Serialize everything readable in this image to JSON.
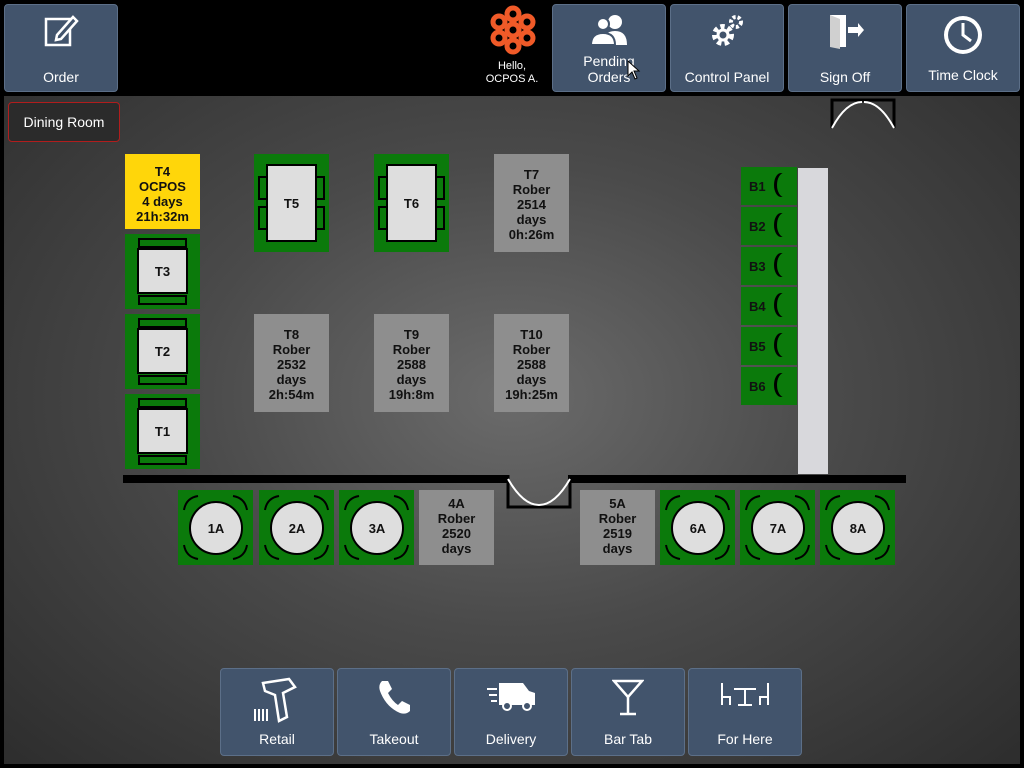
{
  "topbar": {
    "order_label": "Order",
    "hello_line1": "Hello,",
    "hello_line2": "OCPOS A.",
    "pending_line1": "Pending",
    "pending_line2": "Orders",
    "control_panel_label": "Control Panel",
    "sign_off_label": "Sign Off",
    "time_clock_label": "Time Clock"
  },
  "room": {
    "name": "Dining Room"
  },
  "tables": {
    "T4": {
      "line1": "T4",
      "line2": "OCPOS",
      "line3": "4 days",
      "line4": "21h:32m",
      "status": "yellow"
    },
    "T3": {
      "label": "T3"
    },
    "T2": {
      "label": "T2"
    },
    "T1": {
      "label": "T1"
    },
    "T5": {
      "label": "T5"
    },
    "T6": {
      "label": "T6"
    },
    "T7": {
      "line1": "T7",
      "line2": "Rober",
      "line3": "2514",
      "line4": "days",
      "line5": "0h:26m"
    },
    "T8": {
      "line1": "T8",
      "line2": "Rober",
      "line3": "2532",
      "line4": "days",
      "line5": "2h:54m"
    },
    "T9": {
      "line1": "T9",
      "line2": "Rober",
      "line3": "2588",
      "line4": "days",
      "line5": "19h:8m"
    },
    "T10": {
      "line1": "T10",
      "line2": "Rober",
      "line3": "2588",
      "line4": "days",
      "line5": "19h:25m"
    },
    "1A": {
      "label": "1A"
    },
    "2A": {
      "label": "2A"
    },
    "3A": {
      "label": "3A"
    },
    "4A": {
      "line1": "4A",
      "line2": "Rober",
      "line3": "2520",
      "line4": "days"
    },
    "5A": {
      "line1": "5A",
      "line2": "Rober",
      "line3": "2519",
      "line4": "days"
    },
    "6A": {
      "label": "6A"
    },
    "7A": {
      "label": "7A"
    },
    "8A": {
      "label": "8A"
    }
  },
  "bar_seats": [
    "B1",
    "B2",
    "B3",
    "B4",
    "B5",
    "B6"
  ],
  "bottombar": {
    "retail_label": "Retail",
    "takeout_label": "Takeout",
    "delivery_label": "Delivery",
    "bar_tab_label": "Bar Tab",
    "for_here_label": "For Here"
  },
  "colors": {
    "button": "#42546c",
    "open_table": "#0b7a0b",
    "occupied_table": "#8e8e8e",
    "alert_table": "#ffd60a"
  },
  "icons": [
    "edit-icon",
    "ocpos-logo",
    "users-icon",
    "gears-icon",
    "exit-door-icon",
    "clock-icon",
    "barcode-scanner-icon",
    "phone-icon",
    "delivery-van-icon",
    "cocktail-icon",
    "dining-table-icon"
  ]
}
